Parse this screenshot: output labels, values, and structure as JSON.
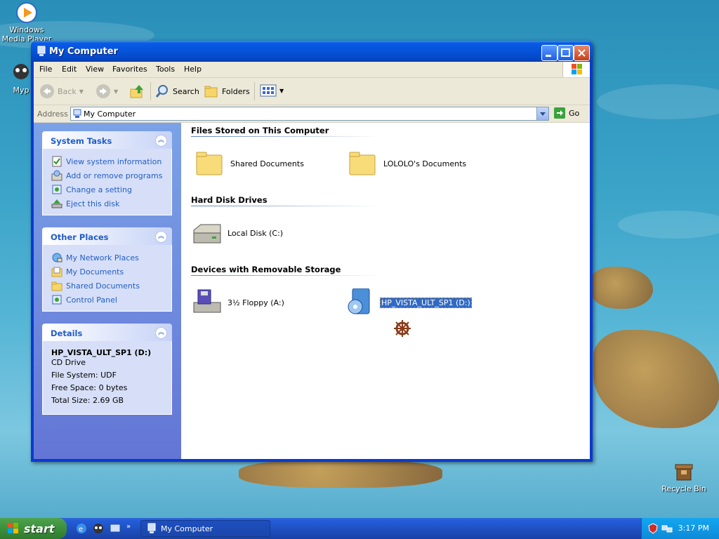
{
  "desktop": {
    "icons": [
      {
        "label": "Windows Media Player",
        "icon": "media-player-icon"
      },
      {
        "label": "Myp",
        "icon": "ie-shortcut-icon"
      },
      {
        "label": "Recycle Bin",
        "icon": "recycle-bin-icon"
      }
    ]
  },
  "window": {
    "title": "My Computer",
    "menu": [
      "File",
      "Edit",
      "View",
      "Favorites",
      "Tools",
      "Help"
    ],
    "toolbar": {
      "back": "Back",
      "search": "Search",
      "folders": "Folders"
    },
    "address": {
      "label": "Address",
      "value": "My Computer",
      "go": "Go"
    },
    "left_pane": {
      "system_tasks": {
        "title": "System Tasks",
        "items": [
          "View system information",
          "Add or remove programs",
          "Change a setting",
          "Eject this disk"
        ]
      },
      "other_places": {
        "title": "Other Places",
        "items": [
          "My Network Places",
          "My Documents",
          "Shared Documents",
          "Control Panel"
        ]
      },
      "details": {
        "title": "Details",
        "name": "HP_VISTA_ULT_SP1 (D:)",
        "type": "CD Drive",
        "file_system": "File System: UDF",
        "free_space": "Free Space: 0 bytes",
        "total_size": "Total Size: 2.69 GB"
      }
    },
    "groups": {
      "files": {
        "title": "Files Stored on This Computer",
        "items": [
          "Shared Documents",
          "LOLOLO's Documents"
        ]
      },
      "hard_disks": {
        "title": "Hard Disk Drives",
        "items": [
          "Local Disk (C:)"
        ]
      },
      "removable": {
        "title": "Devices with Removable Storage",
        "items": [
          "3½ Floppy (A:)",
          "HP_VISTA_ULT_SP1 (D:)"
        ]
      }
    }
  },
  "taskbar": {
    "start": "start",
    "task_button": "My Computer",
    "clock": "3:17 PM"
  },
  "colors": {
    "title_bar": "#0553d9",
    "link_blue": "#215dc6",
    "selection": "#316ac5",
    "start_green": "#3c8f3c"
  }
}
